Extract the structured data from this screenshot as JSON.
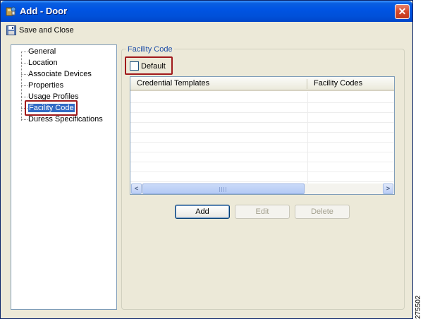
{
  "window": {
    "title": "Add - Door"
  },
  "toolbar": {
    "save_close_label": "Save and Close"
  },
  "nav": {
    "items": [
      {
        "label": "General"
      },
      {
        "label": "Location"
      },
      {
        "label": "Associate Devices"
      },
      {
        "label": "Properties"
      },
      {
        "label": "Usage Profiles"
      },
      {
        "label": "Facility Code",
        "selected": true
      },
      {
        "label": "Duress Specifications"
      }
    ]
  },
  "facility": {
    "group_title": "Facility Code",
    "default_label": "Default",
    "default_checked": false,
    "columns": [
      "Credential Templates",
      "Facility Codes"
    ],
    "rows": []
  },
  "buttons": {
    "add": "Add",
    "edit": "Edit",
    "delete": "Delete"
  },
  "figure_number": "275502",
  "colors": {
    "selection": "#316ac5",
    "highlight": "#a0191b",
    "titlebar": "#0054e3"
  },
  "icons": {
    "window": "door-app-icon",
    "close": "close-icon",
    "save": "save-icon"
  }
}
